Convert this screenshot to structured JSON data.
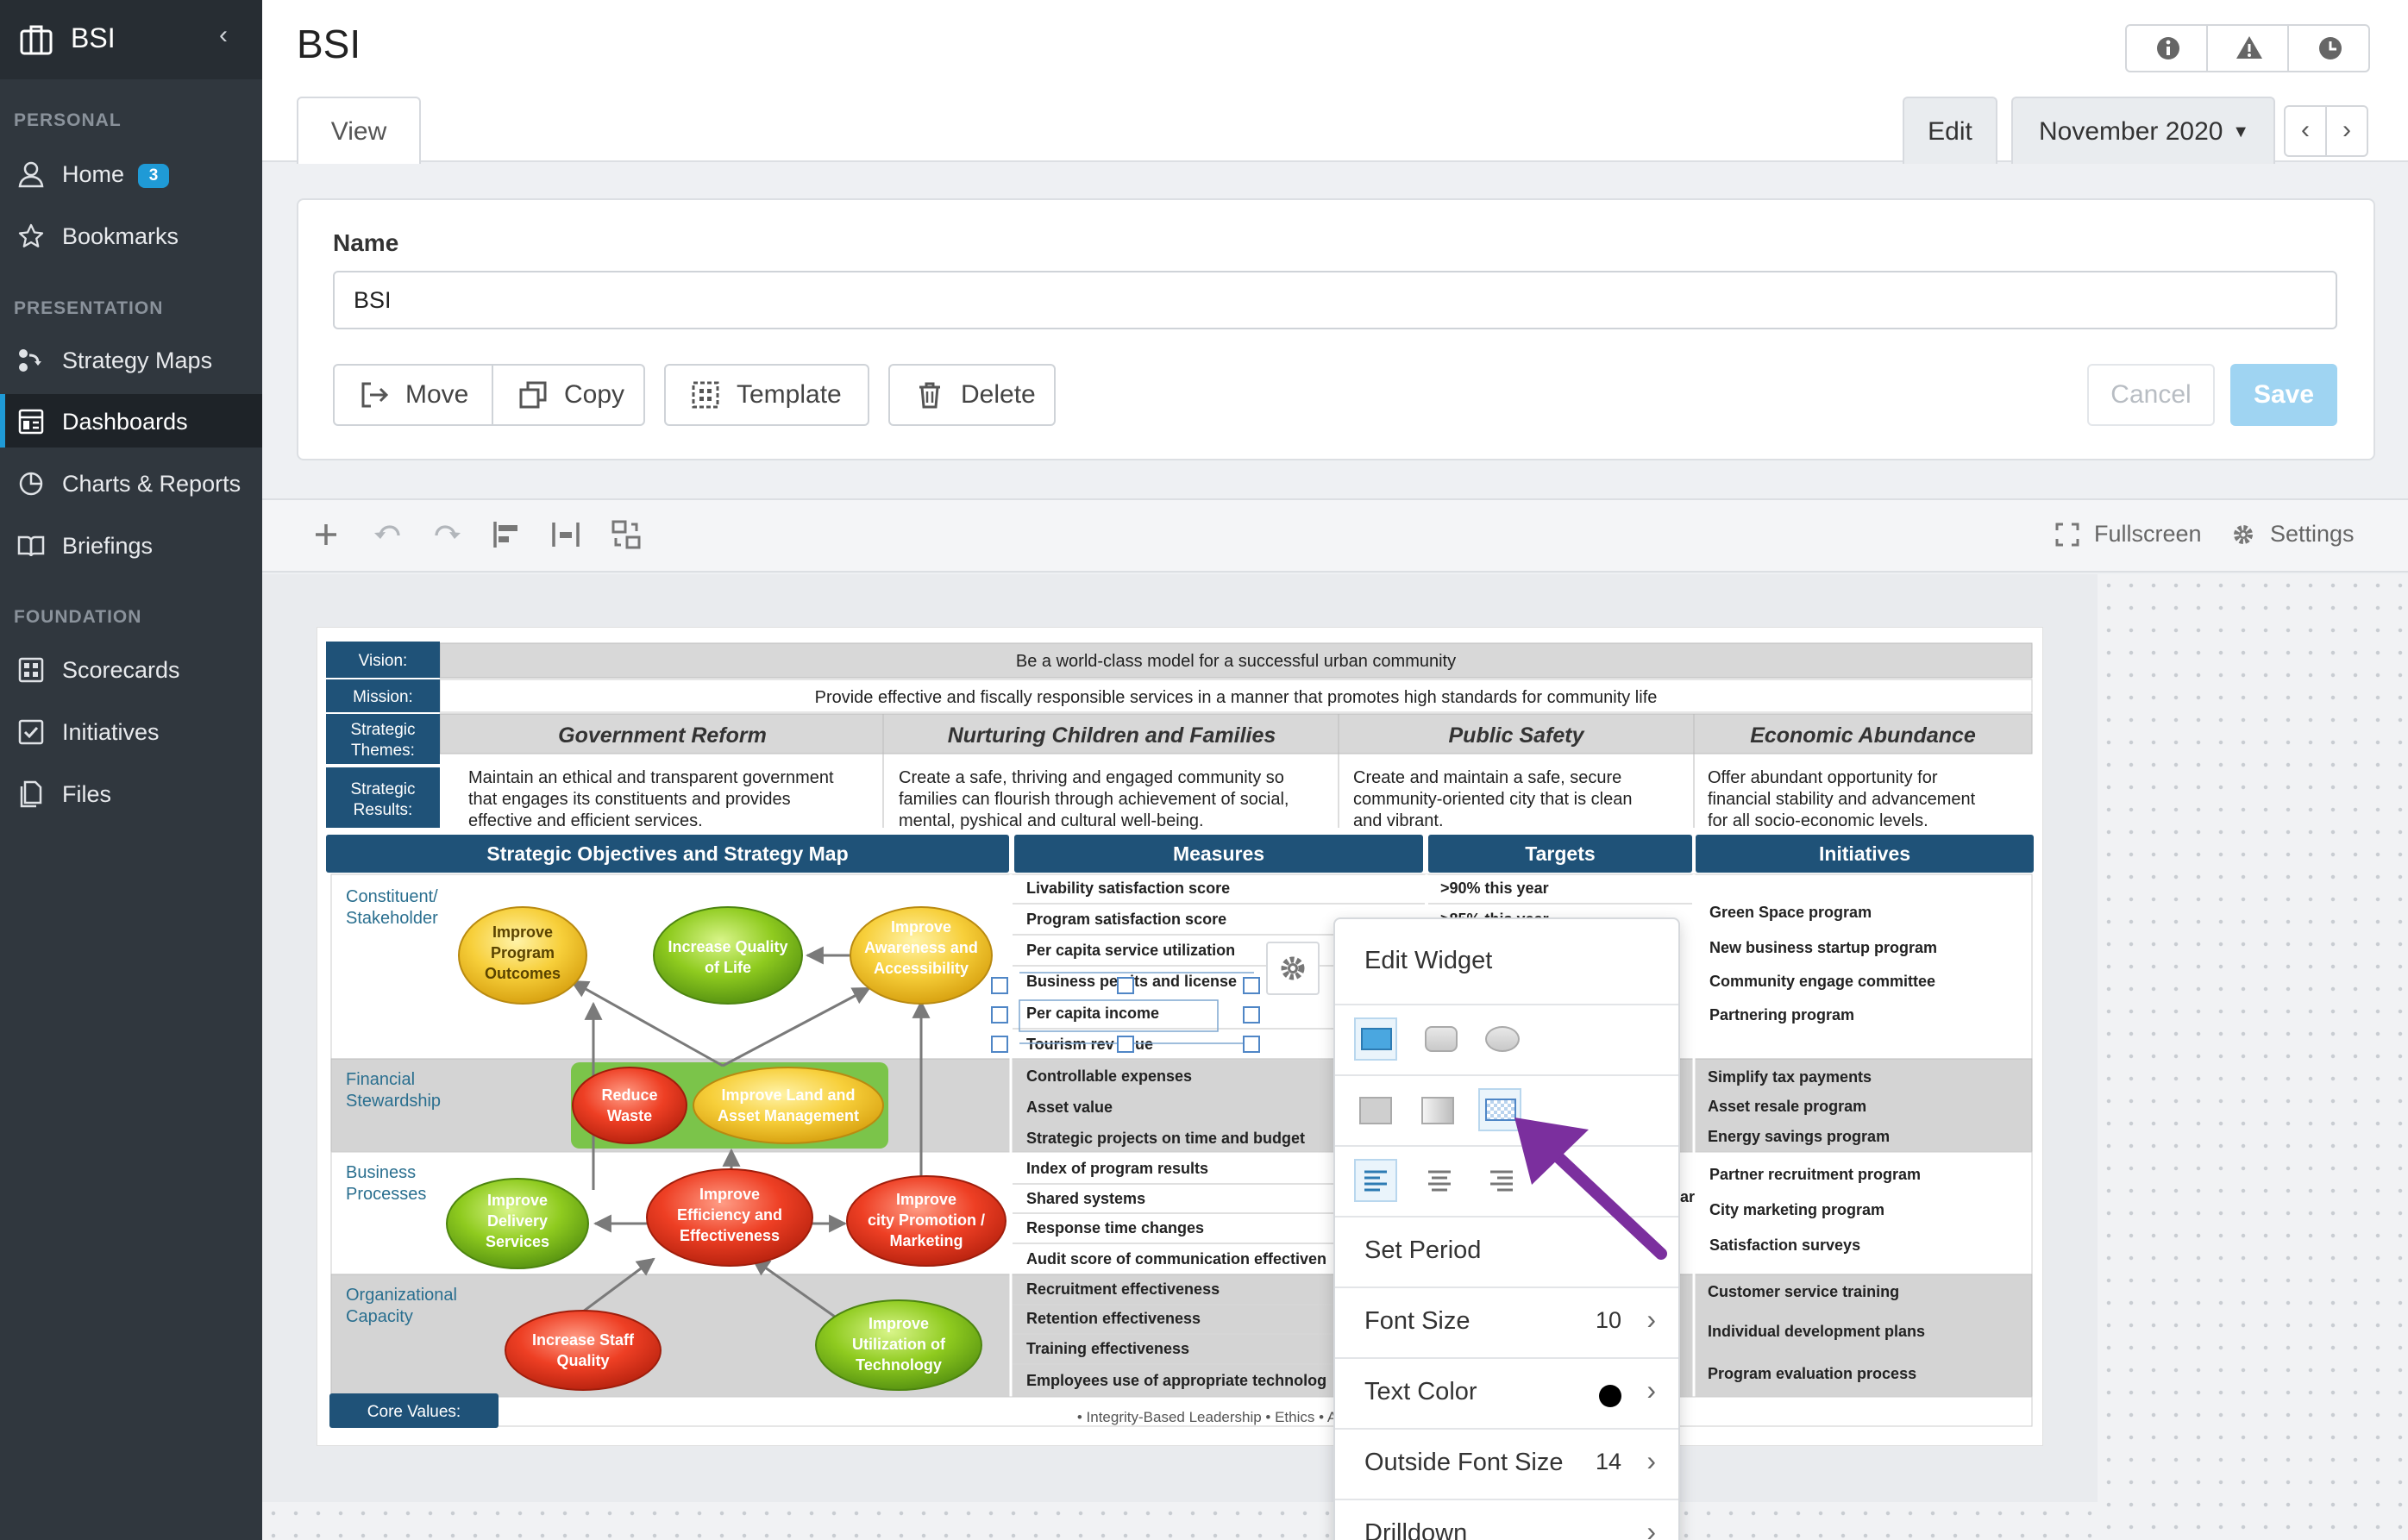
{
  "sidebar": {
    "brand": "BSI",
    "sections": {
      "personal": "PERSONAL",
      "presentation": "PRESENTATION",
      "foundation": "FOUNDATION"
    },
    "items": {
      "home": {
        "label": "Home",
        "badge": "3"
      },
      "bookmarks": {
        "label": "Bookmarks"
      },
      "strategy_maps": {
        "label": "Strategy Maps"
      },
      "dashboards": {
        "label": "Dashboards"
      },
      "charts": {
        "label": "Charts & Reports"
      },
      "briefings": {
        "label": "Briefings"
      },
      "scorecards": {
        "label": "Scorecards"
      },
      "initiatives": {
        "label": "Initiatives"
      },
      "files": {
        "label": "Files"
      }
    }
  },
  "header": {
    "title": "BSI",
    "tab_view": "View",
    "tab_edit": "Edit",
    "period": "November 2020",
    "icons": [
      "info-icon",
      "warning-icon",
      "clock-icon"
    ]
  },
  "form": {
    "name_label": "Name",
    "name_value": "BSI",
    "move": "Move",
    "copy": "Copy",
    "template": "Template",
    "delete": "Delete",
    "cancel": "Cancel",
    "save": "Save"
  },
  "toolbar": {
    "fullscreen": "Fullscreen",
    "settings": "Settings"
  },
  "strategy_map": {
    "vision_label": "Vision:",
    "vision_text": "Be a world-class model for a successful urban community",
    "mission_label": "Mission:",
    "mission_text": "Provide effective and fiscally responsible services in a manner that promotes high standards for community life",
    "themes_label": [
      "Strategic",
      "Themes:"
    ],
    "results_label": [
      "Strategic",
      "Results:"
    ],
    "themes": [
      {
        "title": "Government Reform",
        "result": [
          "Maintain an ethical and transparent government",
          "that engages its constituents and provides",
          "effective and efficient services."
        ]
      },
      {
        "title": "Nurturing Children and Families",
        "result": [
          "Create a safe, thriving and engaged community so",
          "families can flourish through achievement of social,",
          "mental, pyshical and cultural well-being."
        ]
      },
      {
        "title": "Public Safety",
        "result": [
          "Create and maintain a safe, secure",
          "community-oriented city that is clean",
          "and vibrant."
        ]
      },
      {
        "title": "Economic Abundance",
        "result": [
          "Offer abundant opportunity for",
          "financial stability and advancement",
          "for all socio-economic levels."
        ]
      }
    ],
    "col_headers": [
      "Strategic Objectives and Strategy Map",
      "Measures",
      "Targets",
      "Initiatives"
    ],
    "perspectives": [
      [
        "Constituent/",
        "Stakeholder"
      ],
      [
        "Financial",
        "Stewardship"
      ],
      [
        "Business",
        "Processes"
      ],
      [
        "Organizational",
        "Capacity"
      ]
    ],
    "objectives": {
      "o1": [
        "Improve",
        "Program",
        "Outcomes"
      ],
      "o2": [
        "Increase Quality",
        "of Life"
      ],
      "o3": [
        "Improve",
        "Awareness and",
        "Accessibility"
      ],
      "o4": [
        "Reduce",
        "Waste"
      ],
      "o5": [
        "Improve Land and",
        "Asset Management"
      ],
      "o6": [
        "Improve",
        "Delivery",
        "Services"
      ],
      "o7": [
        "Improve",
        "Efficiency and",
        "Effectiveness"
      ],
      "o8": [
        "Improve",
        "city Promotion /",
        "Marketing"
      ],
      "o9": [
        "Increase Staff",
        "Quality"
      ],
      "o10": [
        "Improve",
        "Utilization of",
        "Technology"
      ]
    },
    "measures": [
      "Livability satisfaction score",
      "Program satisfaction score",
      "Per capita service utilization",
      "Business pe",
      "its and license",
      "Per capita income",
      "Tourism rev",
      "ue",
      "Controllable expenses",
      "Asset value",
      "Strategic projects on time and budget",
      "Index of program results",
      "Shared systems",
      "Response time changes",
      "Audit score of communication effectiven",
      "Recruitment effectiveness",
      "Retention effectiveness",
      "Training effectiveness",
      "Employees use of appropriate technolog"
    ],
    "targets": [
      ">90% this year",
      ">85% this year",
      "ar"
    ],
    "initiatives": [
      "Green Space program",
      "New business startup program",
      "Community engage committee",
      "Partnering program",
      "Simplify tax payments",
      "Asset resale program",
      "Energy savings program",
      "Partner recruitment program",
      "City marketing program",
      "Satisfaction surveys",
      "Customer service training",
      "Individual development plans",
      "Program evaluation process"
    ],
    "core_values_label": "Core Values:",
    "core_values_text": "• Integrity-Based Leadership • Ethics • Accountability• Commitment to Excellenc"
  },
  "popover": {
    "title": "Edit Widget",
    "set_period": "Set Period",
    "font_size_label": "Font Size",
    "font_size_value": "10",
    "text_color_label": "Text Color",
    "outside_font_label": "Outside Font Size",
    "outside_font_value": "14",
    "drilldown_label": "Drilldown"
  },
  "colors": {
    "sidebar_bg": "#30373e",
    "accent": "#1f9ad6",
    "map_header": "#1f5278",
    "annotation_arrow": "#7b2f9e"
  }
}
